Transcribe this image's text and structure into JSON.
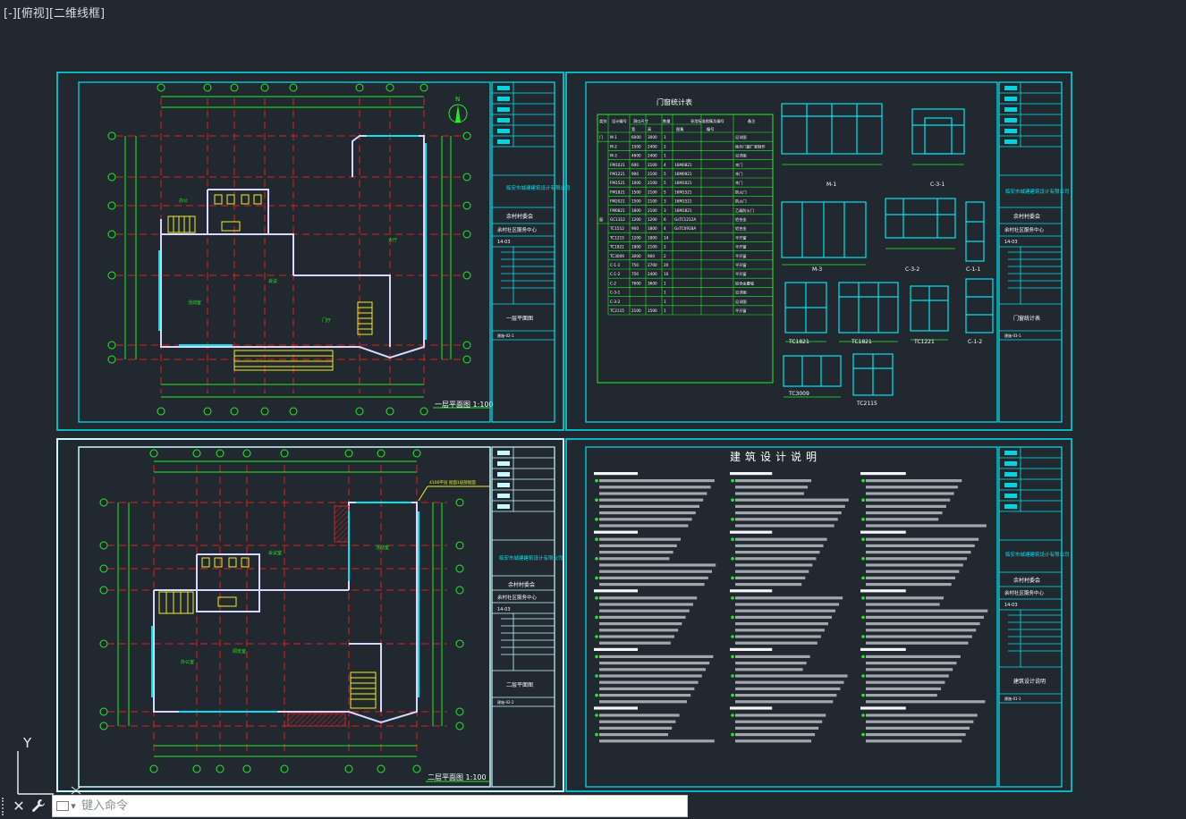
{
  "viewport": {
    "label": "[-][俯视][二维线框]"
  },
  "sheets": {
    "sheet1": {
      "title": "一层平面图 1:100",
      "title_block": {
        "company": "临安市城建建筑设计有限公司",
        "project": "余村村委会",
        "subproject": "余村社区服务中心",
        "code": "14-03",
        "drawing_name": "一层平面图",
        "drawing_no": "建施-02-1"
      }
    },
    "sheet2": {
      "title": "门窗统计表",
      "table_header": [
        "类别",
        "设计编号",
        "洞口尺寸",
        "数量",
        "采用标准图集及编号",
        "备注"
      ],
      "table_subheader": [
        "宽",
        "高",
        "图集",
        "编号"
      ],
      "rows": [
        [
          "门",
          "M-1",
          "6000",
          "3000",
          "1",
          "",
          "",
          "见详图"
        ],
        [
          "",
          "M-2",
          "1500",
          "2400",
          "2",
          "",
          "",
          "除外门窗厂家制作"
        ],
        [
          "",
          "M-3",
          "4600",
          "2400",
          "1",
          "",
          "",
          "见详图"
        ],
        [
          "",
          "FM1021",
          "600",
          "2100",
          "4",
          "16M0821",
          "",
          "木门"
        ],
        [
          "",
          "FM1221",
          "900",
          "2100",
          "5",
          "16M0921",
          "",
          "木门"
        ],
        [
          "",
          "FM1521",
          "1000",
          "2100",
          "5",
          "16M1021",
          "",
          "木门"
        ],
        [
          "",
          "FM1821",
          "1500",
          "2100",
          "5",
          "16M1521",
          "",
          "防火门"
        ],
        [
          "",
          "FM2021",
          "1500",
          "2100",
          "3",
          "16M1521",
          "",
          "防火门"
        ],
        [
          "",
          "FM0821",
          "1800",
          "2100",
          "3",
          "16M1821",
          "",
          "乙级防火门"
        ],
        [
          "窗",
          "GC1312",
          "1200",
          "1200",
          "6",
          "GsTC1212A",
          "",
          "铝合金"
        ],
        [
          "",
          "TC1512",
          "900",
          "1800",
          "4",
          "GsTC0918A",
          "",
          "铝合金"
        ],
        [
          "",
          "TC1215",
          "1200",
          "1800",
          "14",
          "",
          "",
          "平开窗"
        ],
        [
          "",
          "TC1821",
          "1800",
          "2100",
          "2",
          "",
          "",
          "平开窗"
        ],
        [
          "",
          "TC3009",
          "3000",
          "900",
          "2",
          "",
          "",
          "平开窗"
        ],
        [
          "",
          "C-1-1",
          "750",
          "2700",
          "20",
          "",
          "",
          "平开窗"
        ],
        [
          "",
          "C-1-2",
          "750",
          "2400",
          "10",
          "",
          "",
          "平开窗"
        ],
        [
          "",
          "C-2",
          "7600",
          "3600",
          "1",
          "",
          "",
          "铝合金幕墙"
        ],
        [
          "",
          "C-3-1",
          "",
          "",
          "1",
          "",
          "",
          "见详图"
        ],
        [
          "",
          "C-3-2",
          "",
          "",
          "1",
          "",
          "",
          "见详图"
        ],
        [
          "",
          "TC2115",
          "2100",
          "1500",
          "1",
          "",
          "",
          "平开窗"
        ]
      ],
      "elevation_labels": [
        "M-1",
        "C-3-1",
        "M-3",
        "C-3-2",
        "C-1-1",
        "TC1821",
        "TC1821",
        "TC1221",
        "C-1-2",
        "TC3009",
        "TC2115"
      ],
      "title_block": {
        "company": "临安市城建建筑设计有限公司",
        "project": "余村村委会",
        "subproject": "余村社区服务中心",
        "code": "14-03",
        "drawing_name": "门窗统计表",
        "drawing_no": "建施-03-1"
      }
    },
    "sheet3": {
      "title": "二层平面图 1:100",
      "callout": "4100平层 屋面1层部屋面",
      "title_block": {
        "company": "临安市城建建筑设计有限公司",
        "project": "余村村委会",
        "subproject": "余村社区服务中心",
        "code": "14-03",
        "drawing_name": "二层平面图",
        "drawing_no": "建施-02-2"
      }
    },
    "sheet4": {
      "title": "建筑设计说明",
      "title_block": {
        "company": "临安市城建建筑设计有限公司",
        "project": "余村村委会",
        "subproject": "余村社区服务中心",
        "code": "14-03",
        "drawing_name": "建筑设计说明",
        "drawing_no": "建施-01-1"
      }
    }
  },
  "command_line": {
    "placeholder": "键入命令"
  },
  "ucs": {
    "y_label": "Y"
  },
  "colors": {
    "background": "#212830",
    "sheet_border": "#00e5ee",
    "drawing_line": "#22ee22",
    "axis_grid": "#ee2222",
    "walls": "#d8d8ff",
    "text_yellow": "#eeee22",
    "title_block_fill": "#00d4dd"
  }
}
